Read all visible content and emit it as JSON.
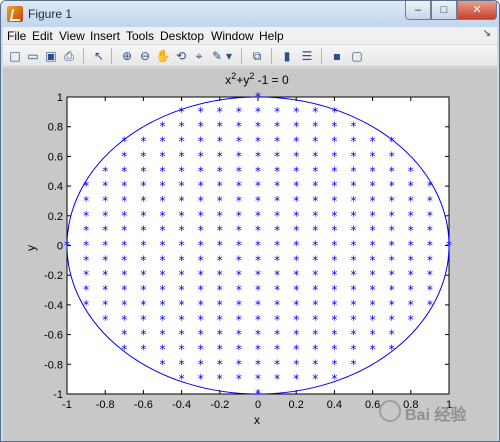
{
  "window": {
    "title": "Figure 1",
    "min_glyph": "–",
    "max_glyph": "□",
    "close_glyph": "✕"
  },
  "menubar": {
    "items": [
      "File",
      "Edit",
      "View",
      "Insert",
      "Tools",
      "Desktop",
      "Window",
      "Help"
    ],
    "dock_glyph": "↘"
  },
  "toolbar": {
    "buttons": [
      {
        "name": "new-figure-icon",
        "glyph": "□"
      },
      {
        "name": "open-file-icon",
        "glyph": "▭"
      },
      {
        "name": "save-icon",
        "glyph": "▣"
      },
      {
        "name": "print-icon",
        "glyph": "⎙"
      },
      {
        "name": "edit-plot-icon",
        "glyph": "↖"
      },
      {
        "name": "zoom-in-icon",
        "glyph": "⊕"
      },
      {
        "name": "zoom-out-icon",
        "glyph": "⊖"
      },
      {
        "name": "pan-icon",
        "glyph": "✋"
      },
      {
        "name": "rotate-3d-icon",
        "glyph": "⟲"
      },
      {
        "name": "data-cursor-icon",
        "glyph": "⌖"
      },
      {
        "name": "brush-icon",
        "glyph": "✎"
      },
      {
        "name": "brush-dropdown-icon",
        "glyph": "▾"
      },
      {
        "name": "link-plot-icon",
        "glyph": "⧉"
      },
      {
        "name": "colorbar-icon",
        "glyph": "▮"
      },
      {
        "name": "legend-icon",
        "glyph": "☰"
      },
      {
        "name": "hide-tools-icon",
        "glyph": "▪"
      },
      {
        "name": "show-tools-icon",
        "glyph": "▢"
      }
    ]
  },
  "chart_data": {
    "type": "scatter",
    "title_base": "x",
    "title_sup1": "2",
    "title_mid": "+y",
    "title_sup2": "2",
    "title_tail": " -1 = 0",
    "xlabel": "x",
    "ylabel": "y",
    "xlim": [
      -1,
      1
    ],
    "ylim": [
      -1,
      1
    ],
    "xticks": [
      "-1",
      "-0.8",
      "-0.6",
      "-0.4",
      "-0.2",
      "0",
      "0.2",
      "0.4",
      "0.6",
      "0.8",
      "1"
    ],
    "yticks": [
      "-1",
      "-0.8",
      "-0.6",
      "-0.4",
      "-0.2",
      "0",
      "0.2",
      "0.4",
      "0.6",
      "0.8",
      "1"
    ],
    "grid": false,
    "marker": "*",
    "color": "#0000ff",
    "grid_step": 0.1,
    "series": [
      {
        "type": "curve",
        "equation": "x^2+y^2-1=0"
      },
      {
        "type": "points",
        "rule": "x^2+y^2 < 1 on 0.1 grid",
        "extra_points": [
          [
            -1,
            0
          ],
          [
            1,
            0
          ],
          [
            0,
            1
          ],
          [
            0,
            -1
          ]
        ]
      }
    ]
  },
  "watermark": {
    "text": "Bai 经验"
  }
}
